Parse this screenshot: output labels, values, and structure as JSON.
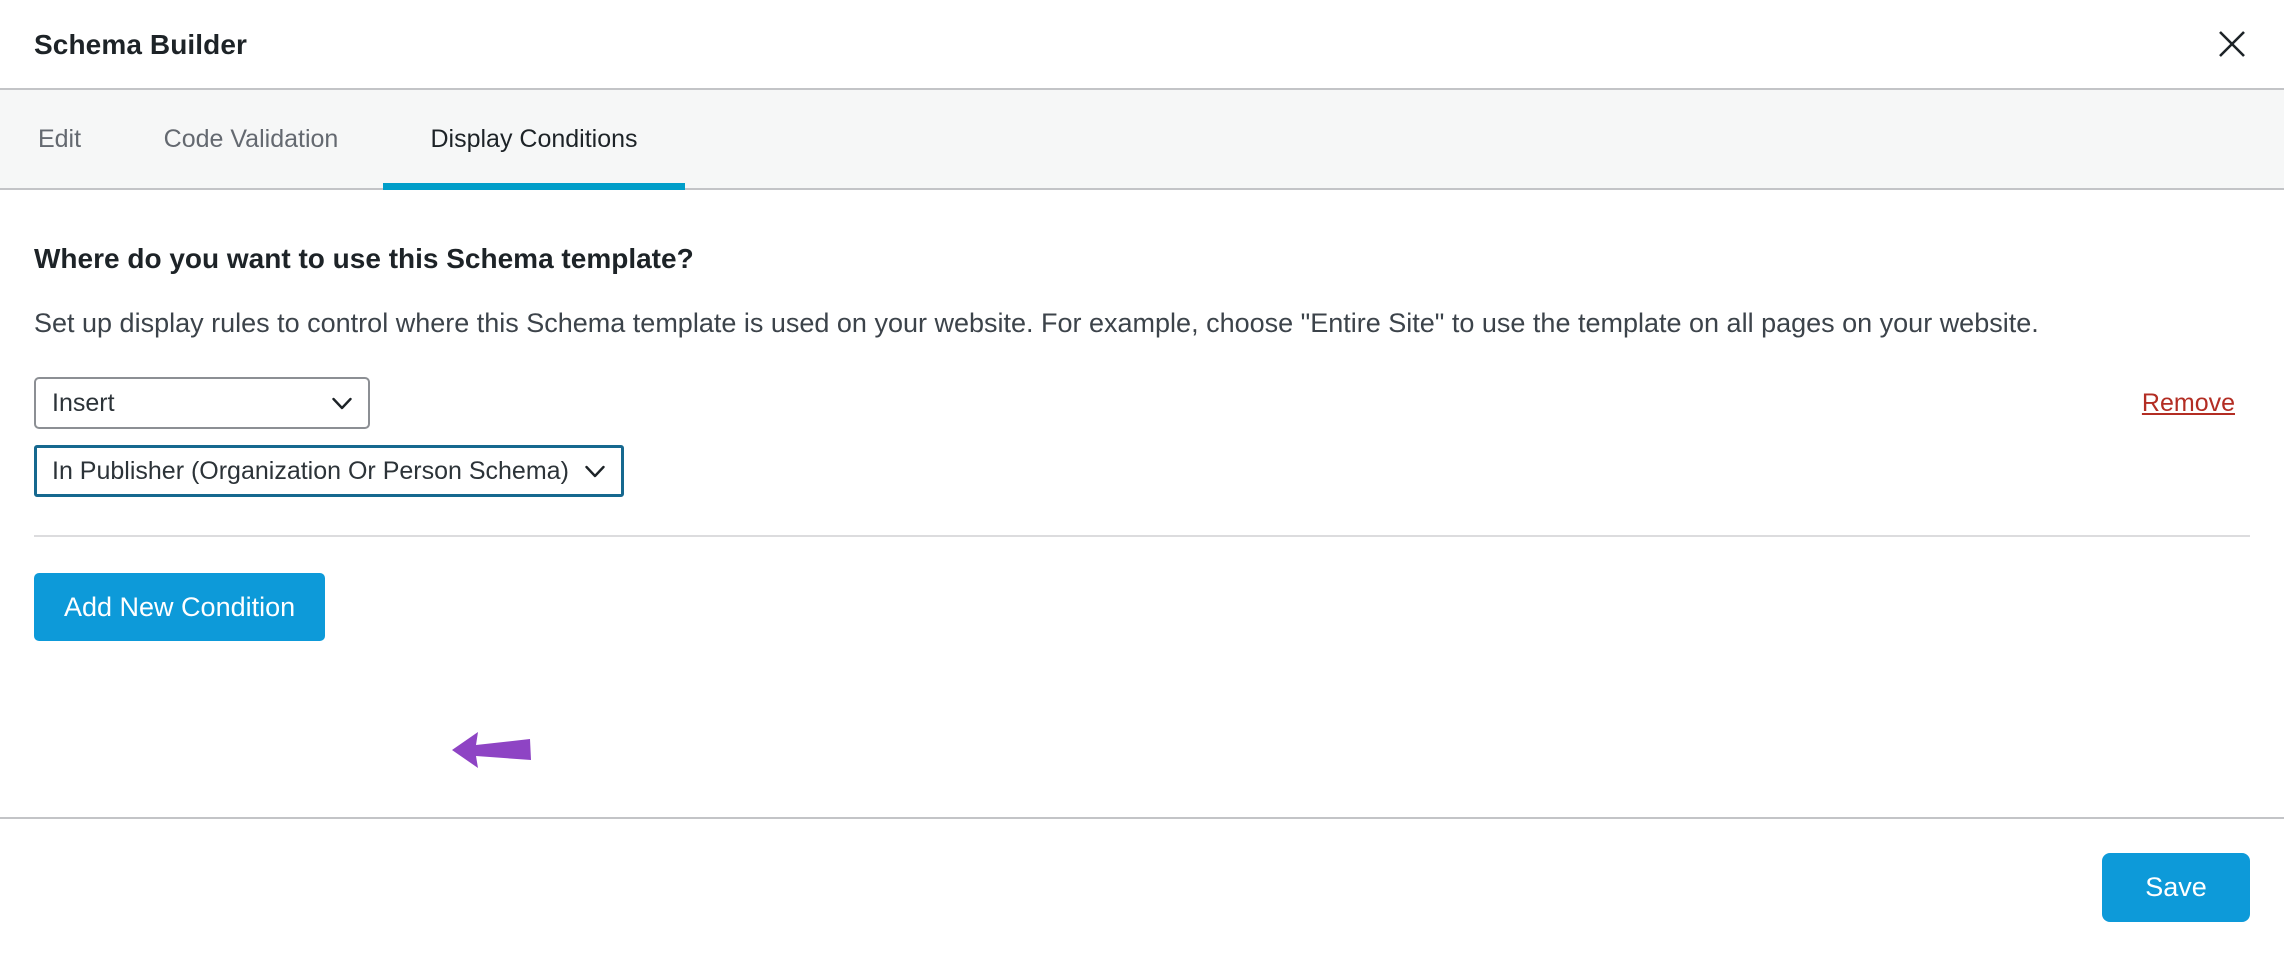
{
  "header": {
    "title": "Schema Builder",
    "close_icon": "close-icon"
  },
  "tabs": [
    {
      "label": "Edit",
      "active": false
    },
    {
      "label": "Code Validation",
      "active": false
    },
    {
      "label": "Display Conditions",
      "active": true
    }
  ],
  "main": {
    "heading": "Where do you want to use this Schema template?",
    "description": "Set up display rules to control where this Schema template is used on your website. For example, choose \"Entire Site\" to use the template on all pages on your website.",
    "condition": {
      "action_select": {
        "value": "Insert",
        "caret_icon": "chevron-down-icon"
      },
      "target_select": {
        "value": "In Publisher (Organization Or Person Schema)",
        "caret_icon": "chevron-down-icon",
        "focused": true
      },
      "remove_label": "Remove"
    },
    "add_condition_label": "Add New Condition"
  },
  "footer": {
    "save_label": "Save"
  },
  "annotation": {
    "arrow_icon": "left-pointing-arrow",
    "arrow_color": "#8e44c4"
  },
  "colors": {
    "accent_blue": "#0d9ad9",
    "tab_underline": "#009ec9",
    "focus_border": "#16688f",
    "remove_red": "#b32d23"
  }
}
